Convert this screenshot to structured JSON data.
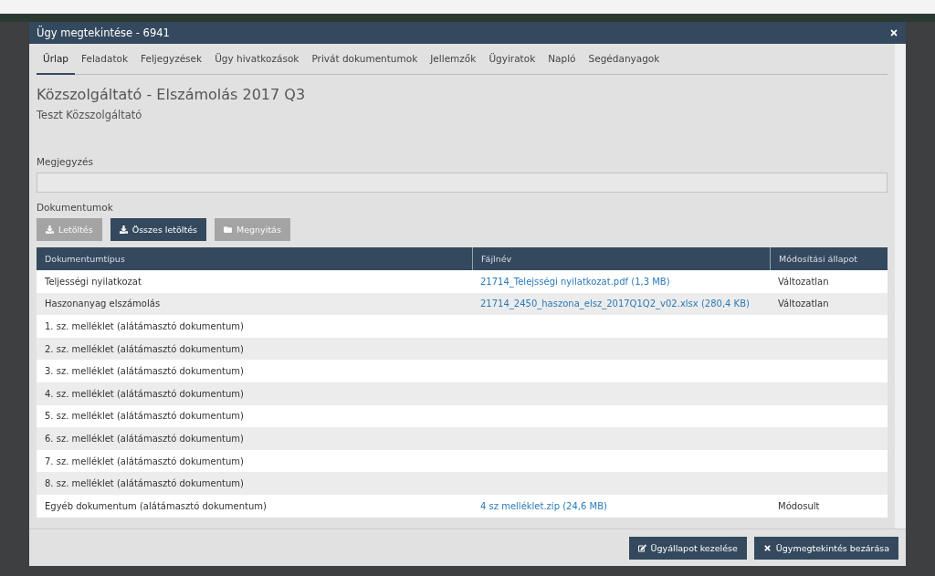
{
  "window": {
    "title": "Ügy megtekintése - 6941"
  },
  "tabs": [
    {
      "label": "Űrlap",
      "selected": true
    },
    {
      "label": "Feladatok",
      "selected": false
    },
    {
      "label": "Feljegyzések",
      "selected": false
    },
    {
      "label": "Ügy hivatkozások",
      "selected": false
    },
    {
      "label": "Privát dokumentumok",
      "selected": false
    },
    {
      "label": "Jellemzők",
      "selected": false
    },
    {
      "label": "Ügyiratok",
      "selected": false
    },
    {
      "label": "Napló",
      "selected": false
    },
    {
      "label": "Segédanyagok",
      "selected": false
    }
  ],
  "heading": "Közszolgáltató - Elszámolás 2017 Q3",
  "subheading": "Teszt Közszolgáltató",
  "note": {
    "label": "Megjegyzés"
  },
  "documents": {
    "label": "Dokumentumok",
    "buttons": [
      {
        "label": "Letöltés",
        "kind": "download",
        "disabled": true
      },
      {
        "label": "Összes letöltés",
        "kind": "download",
        "disabled": false
      },
      {
        "label": "Megnyitás",
        "kind": "open",
        "disabled": true
      }
    ],
    "columns": [
      "Dokumentumtípus",
      "Fájlnév",
      "Módosítási állapot"
    ],
    "rows": [
      {
        "type": "Teljességi nyilatkozat",
        "file": "21714_Telejsségi nyilatkozat.pdf (1,3 MB)",
        "status": "Változatlan"
      },
      {
        "type": "Haszonanyag elszámolás",
        "file": "21714_2450_haszona_elsz_2017Q1Q2_v02.xlsx (280,4 KB)",
        "status": "Változatlan"
      },
      {
        "type": "1. sz. melléklet (alátámasztó dokumentum)"
      },
      {
        "type": "2. sz. melléklet (alátámasztó dokumentum)"
      },
      {
        "type": "3. sz. melléklet (alátámasztó dokumentum)"
      },
      {
        "type": "4. sz. melléklet (alátámasztó dokumentum)"
      },
      {
        "type": "5. sz. melléklet (alátámasztó dokumentum)"
      },
      {
        "type": "6. sz. melléklet (alátámasztó dokumentum)"
      },
      {
        "type": "7. sz. melléklet (alátámasztó dokumentum)"
      },
      {
        "type": "8. sz. melléklet (alátámasztó dokumentum)"
      },
      {
        "type": "Egyéb dokumentum (alátámasztó dokumentum)",
        "file": "4 sz melléklet.zip (24,6 MB)",
        "status": "Módosult"
      }
    ]
  },
  "footer_buttons": [
    {
      "label": "Ügyállapot kezelése",
      "kind": "edit"
    },
    {
      "label": "Ügymegtekintés bezárása",
      "kind": "close"
    }
  ]
}
